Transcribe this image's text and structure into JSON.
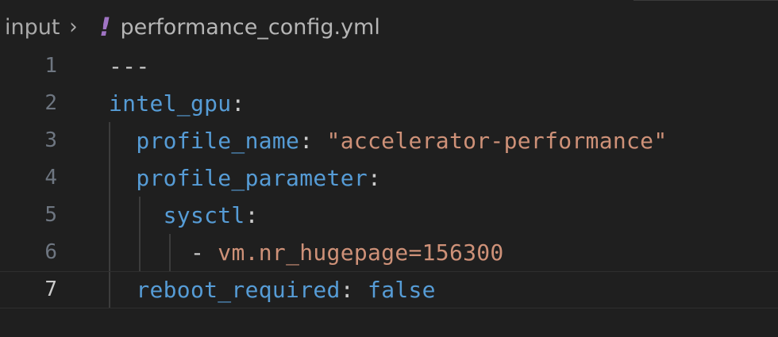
{
  "breadcrumb": {
    "folder": "input",
    "separator": "›",
    "file_icon": "!",
    "file": "performance_config.yml"
  },
  "editor": {
    "lines": [
      {
        "number": "1",
        "indent": "",
        "key": "",
        "colon": "",
        "value": "---",
        "value_kind": "plain"
      },
      {
        "number": "2",
        "indent": "",
        "key": "intel_gpu",
        "colon": ":",
        "value": "",
        "value_kind": ""
      },
      {
        "number": "3",
        "indent": "  ",
        "key": "profile_name",
        "colon": ":",
        "value": " \"accelerator-performance\"",
        "value_kind": "string"
      },
      {
        "number": "4",
        "indent": "  ",
        "key": "profile_parameter",
        "colon": ":",
        "value": "",
        "value_kind": ""
      },
      {
        "number": "5",
        "indent": "    ",
        "key": "sysctl",
        "colon": ":",
        "value": "",
        "value_kind": ""
      },
      {
        "number": "6",
        "indent": "      ",
        "key": "",
        "colon": "",
        "dash": "- ",
        "value": "vm.nr_hugepage=156300",
        "value_kind": "string"
      },
      {
        "number": "7",
        "indent": "  ",
        "key": "reboot_required",
        "colon": ":",
        "value": " false",
        "value_kind": "bool"
      }
    ],
    "current_line": "7"
  },
  "colors": {
    "background": "#1f1f1f",
    "key": "#569cd6",
    "string": "#ce9178",
    "punctuation": "#cccccc",
    "line_number": "#6e7681",
    "yaml_icon": "#a074c4"
  }
}
